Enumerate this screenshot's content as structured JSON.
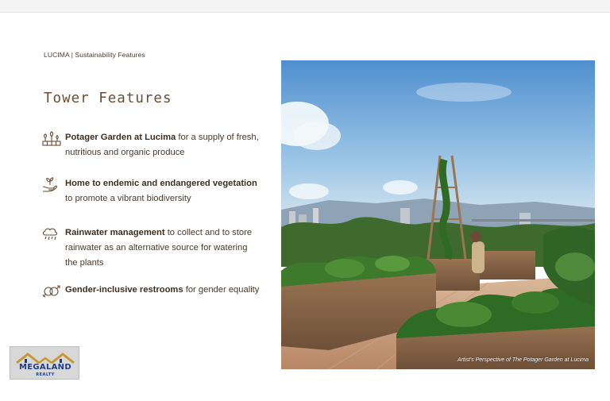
{
  "slide": {
    "breadcrumb": "LUCIMA | Sustainability Features",
    "title": "Tower Features"
  },
  "features": [
    {
      "icon": "garden-icon",
      "bold_line1": "Potager Garden at Lucima",
      "rest_line1": " for a supply of fresh,",
      "line2": "nutritious and organic produce"
    },
    {
      "icon": "plant-hand-icon",
      "bold_line1": "Home to endemic and endangered vegetation",
      "line2": "to promote a vibrant biodiversity"
    },
    {
      "icon": "rain-cloud-icon",
      "bold_line1": "Rainwater management",
      "rest_line1": " to collect and to store",
      "line2": "rainwater as an alternative source for watering",
      "line3": "the plants"
    },
    {
      "icon": "gender-symbol-icon",
      "bold_line1": "Gender-inclusive restrooms",
      "rest_line1": " for gender equality"
    }
  ],
  "photo": {
    "caption": "Artist's Perspective of The Potager Garden at Lucima"
  },
  "logo": {
    "brand": "MEGALAND",
    "sub": "REALTY"
  },
  "colors": {
    "title": "#6b4c35",
    "text": "#4a3a2c",
    "logo_blue": "#1f3e8a"
  }
}
